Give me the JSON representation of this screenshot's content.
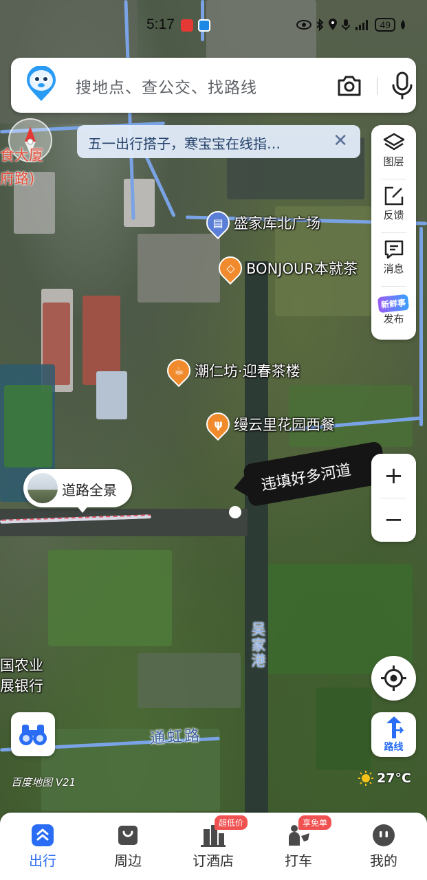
{
  "status_bar": {
    "time": "5:17",
    "battery": "49"
  },
  "search": {
    "placeholder": "搜地点、查公交、找路线"
  },
  "banner": {
    "text": "五一出行搭子，寒宝宝在线指…",
    "close_glyph": "✕"
  },
  "tools": [
    {
      "label": "图层",
      "icon": "layers-icon"
    },
    {
      "label": "反馈",
      "icon": "feedback-edit-icon"
    },
    {
      "label": "消息",
      "icon": "message-icon"
    },
    {
      "label": "发布",
      "icon": "fresh-news-icon",
      "badge": "新鲜事"
    }
  ],
  "zoom": {
    "in": "+",
    "out": "−"
  },
  "route_button": {
    "label": "路线"
  },
  "street_view": {
    "label": "道路全景"
  },
  "pois": [
    {
      "name": "盛家库北广场",
      "icon": "building-icon",
      "color": "#5b7fd6"
    },
    {
      "name": "BONJOUR本就茶",
      "icon": "teashop-icon",
      "color": "#f08a2c"
    },
    {
      "name": "潮仁坊·迎春茶楼",
      "icon": "cup-icon",
      "color": "#f08a2c"
    },
    {
      "name": "缦云里花园西餐",
      "icon": "fork-knife-icon",
      "color": "#f08a2c"
    }
  ],
  "map_labels": {
    "top_left_1": "食大厦",
    "top_left_2": "府路)",
    "bank_1": "国农业",
    "bank_2": "展银行",
    "river": "吴家港",
    "road": "通虹路"
  },
  "note": {
    "text": "违填好多河道"
  },
  "brand": "百度地图 V21",
  "weather": {
    "temp": "27°C"
  },
  "bottom_nav": [
    {
      "label": "出行",
      "active": true
    },
    {
      "label": "周边",
      "active": false
    },
    {
      "label": "订酒店",
      "active": false,
      "badge": "超低价"
    },
    {
      "label": "打车",
      "active": false,
      "badge": "享免单"
    },
    {
      "label": "我的",
      "active": false
    }
  ]
}
